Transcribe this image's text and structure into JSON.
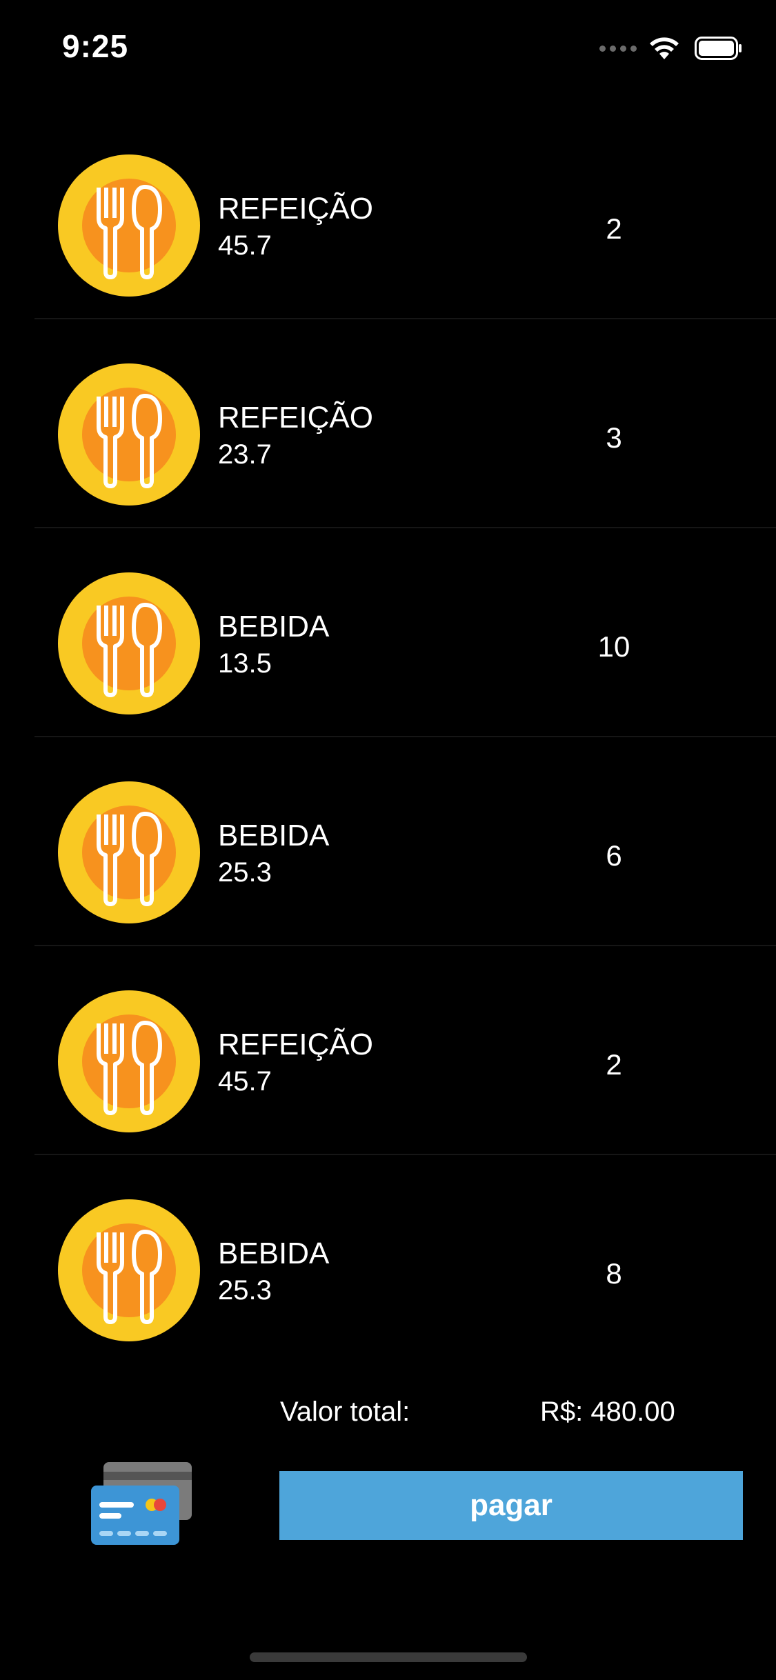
{
  "status_bar": {
    "time": "9:25",
    "icons": [
      "signal-dots-icon",
      "wifi-icon",
      "battery-icon"
    ]
  },
  "orders": [
    {
      "name": "REFEIÇÃO",
      "price": "45.7",
      "quantity": "2",
      "icon": "fork-spoon-icon"
    },
    {
      "name": "REFEIÇÃO",
      "price": "23.7",
      "quantity": "3",
      "icon": "fork-spoon-icon"
    },
    {
      "name": "BEBIDA",
      "price": "13.5",
      "quantity": "10",
      "icon": "fork-spoon-icon"
    },
    {
      "name": "BEBIDA",
      "price": "25.3",
      "quantity": "6",
      "icon": "fork-spoon-icon"
    },
    {
      "name": "REFEIÇÃO",
      "price": "45.7",
      "quantity": "2",
      "icon": "fork-spoon-icon"
    },
    {
      "name": "BEBIDA",
      "price": "25.3",
      "quantity": "8",
      "icon": "fork-spoon-icon"
    }
  ],
  "footer": {
    "total_label": "Valor total:",
    "total_value": "R$: 480.00",
    "pay_label": "pagar",
    "payment_icon": "credit-card-icon"
  },
  "colors": {
    "background": "#000000",
    "icon_outer": "#f9c923",
    "icon_inner": "#f7921e",
    "pay_button": "#4ea5da"
  }
}
